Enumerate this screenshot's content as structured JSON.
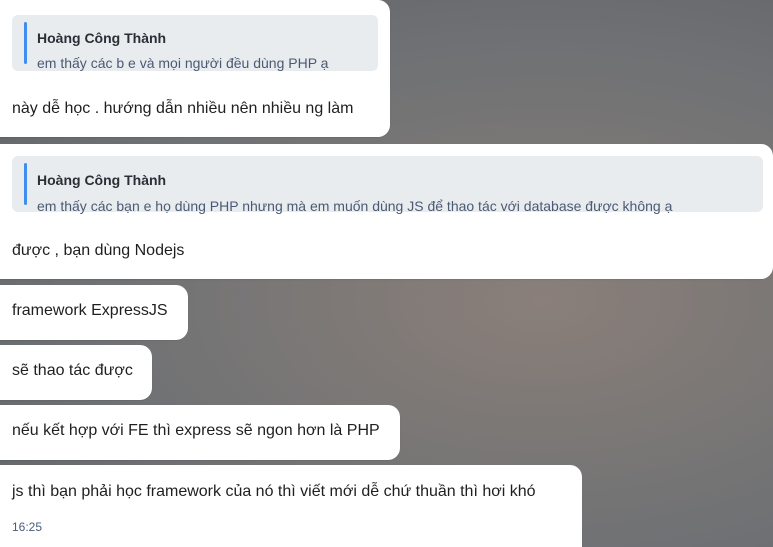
{
  "messages": [
    {
      "quote": {
        "author": "Hoàng Công Thành",
        "text": "em thấy các b e và mọi người đều dùng PHP ạ"
      },
      "text": "này dễ học . hướng dẫn nhiều nên nhiều ng làm"
    },
    {
      "quote": {
        "author": "Hoàng Công Thành",
        "text": "em thấy các bạn e họ dùng PHP nhưng mà em muốn dùng JS để thao tác với database được không ạ"
      },
      "text": "được , bạn dùng Nodejs"
    },
    {
      "text": "framework ExpressJS"
    },
    {
      "text": "sẽ thao tác được"
    },
    {
      "text": "nếu kết hợp với FE thì express sẽ ngon hơn là PHP"
    },
    {
      "text": "js thì bạn phải học framework của nó thì viết mới dễ chứ thuần thì hơi khó",
      "time": "16:25"
    }
  ],
  "colors": {
    "bubble": "#ffffff",
    "quote_bg": "#e9ecef",
    "quote_bar": "#3f8ef0",
    "quote_text": "#4a5a72",
    "timestamp": "#4a5d7a"
  }
}
